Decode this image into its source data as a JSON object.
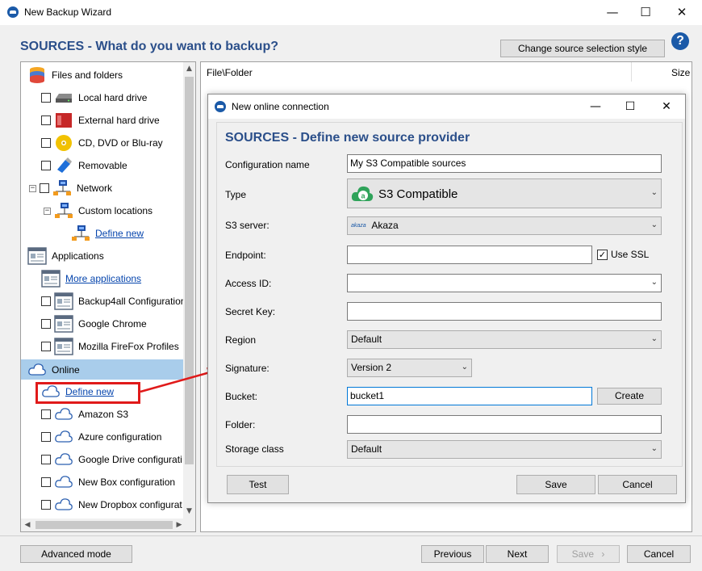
{
  "window": {
    "title": "New Backup Wizard",
    "minimize": "—",
    "maximize": "☐",
    "close": "✕"
  },
  "header": {
    "title": "SOURCES - What do you want to backup?",
    "change_style_button": "Change source selection style",
    "help": "?"
  },
  "tree": {
    "items": [
      {
        "label": "Files and folders",
        "icon": "database-icon"
      },
      {
        "label": "Local hard drive",
        "icon": "hard-drive-icon"
      },
      {
        "label": "External hard drive",
        "icon": "external-drive-icon"
      },
      {
        "label": "CD, DVD or Blu-ray",
        "icon": "disc-icon"
      },
      {
        "label": "Removable",
        "icon": "usb-icon"
      },
      {
        "label": "Network",
        "icon": "network-icon"
      },
      {
        "label": "Custom locations",
        "icon": "network-icon"
      },
      {
        "label": "Define new",
        "icon": "network-icon"
      },
      {
        "label": "Applications",
        "icon": "application-icon"
      },
      {
        "label": "More applications",
        "icon": "application-icon"
      },
      {
        "label": "Backup4all Configuration",
        "icon": "application-icon"
      },
      {
        "label": "Google Chrome",
        "icon": "application-icon"
      },
      {
        "label": "Mozilla FireFox Profiles",
        "icon": "application-icon"
      },
      {
        "label": "Online",
        "icon": "cloud-icon"
      },
      {
        "label": "Define new",
        "icon": "cloud-icon"
      },
      {
        "label": "Amazon S3",
        "icon": "cloud-icon"
      },
      {
        "label": "Azure configuration",
        "icon": "cloud-icon"
      },
      {
        "label": "Google Drive configurati",
        "icon": "cloud-icon"
      },
      {
        "label": "New Box configuration",
        "icon": "cloud-icon"
      },
      {
        "label": "New Dropbox configurat",
        "icon": "cloud-icon"
      }
    ],
    "expander_minus": "−",
    "scroll_up": "▲",
    "scroll_down": "▼",
    "scroll_left": "◀",
    "scroll_right": "▶"
  },
  "file_list": {
    "columns": [
      "File\\Folder",
      "Size"
    ]
  },
  "dialog": {
    "title": "New online connection",
    "heading": "SOURCES - Define new source provider",
    "fields": {
      "config_name": {
        "label": "Configuration name",
        "value": "My S3 Compatible sources"
      },
      "type": {
        "label": "Type",
        "value": "S3 Compatible"
      },
      "s3_server": {
        "label": "S3 server:",
        "value": "Akaza",
        "logo_text": "akaza"
      },
      "endpoint": {
        "label": "Endpoint:",
        "value": ""
      },
      "use_ssl": {
        "label": "Use SSL",
        "checked": true
      },
      "access_id": {
        "label": "Access ID:",
        "value": ""
      },
      "secret_key": {
        "label": "Secret Key:",
        "value": ""
      },
      "region": {
        "label": "Region",
        "value": "Default"
      },
      "signature": {
        "label": "Signature:",
        "value": "Version 2"
      },
      "bucket": {
        "label": "Bucket:",
        "value": "bucket1"
      },
      "create_button": "Create",
      "folder": {
        "label": "Folder:",
        "value": ""
      },
      "storage_class": {
        "label": "Storage class",
        "value": "Default"
      }
    },
    "test_button": "Test",
    "save_button": "Save",
    "cancel_button": "Cancel"
  },
  "footer": {
    "advanced_mode": "Advanced mode",
    "previous": "Previous",
    "next": "Next",
    "save": "Save",
    "save_arrow": "›",
    "cancel": "Cancel"
  },
  "colors": {
    "heading": "#2b4f8a",
    "selection": "#a9cdeb",
    "annotation": "#e01a1a",
    "link": "#0645ad"
  }
}
